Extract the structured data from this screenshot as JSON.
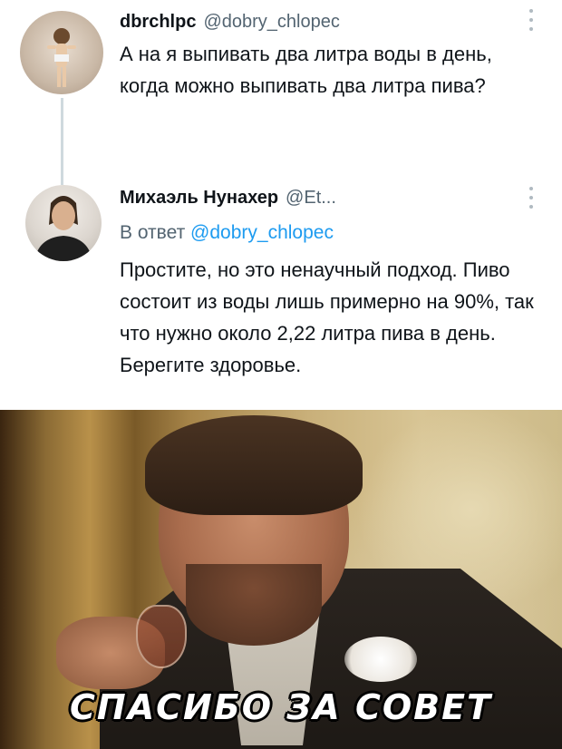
{
  "tweets": [
    {
      "display_name": "dbrchlpc",
      "handle": "@dobry_chlopec",
      "text": "А на    я выпивать два литра воды в день, когда можно выпивать два литра пива?",
      "avatar_icon": "user-avatar-icon"
    },
    {
      "display_name": "Михаэль Нунахер",
      "handle": "@Et...",
      "reply_prefix": "В ответ",
      "reply_mention": "@dobry_chlopec",
      "text": "Простите, но это ненаучный подход. Пиво состоит из воды лишь примерно на 90%, так что нужно около 2,22 литра пива в день. Берегите здоровье.",
      "avatar_icon": "user-avatar-icon"
    }
  ],
  "meme": {
    "caption": "СПАСИБО ЗА СОВЕТ"
  },
  "colors": {
    "link": "#1d9bf0",
    "secondary_text": "#536471",
    "primary_text": "#0f1419",
    "thread_line": "#cfd9de"
  }
}
